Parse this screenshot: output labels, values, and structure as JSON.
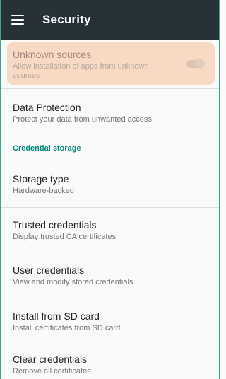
{
  "appbar": {
    "title": "Security",
    "menu_icon": "hamburger-menu-icon",
    "background": "#263238"
  },
  "colors": {
    "accent": "#00897b",
    "highlight": "#f8d9c3"
  },
  "items": {
    "unknown_sources": {
      "title": "Unknown sources",
      "subtitle": "Allow installation of apps from unknown sources",
      "toggle_on": false
    },
    "data_protection": {
      "title": "Data Protection",
      "subtitle": "Protect your data from unwanted access"
    },
    "section_credential_storage": "Credential storage",
    "storage_type": {
      "title": "Storage type",
      "subtitle": "Hardware-backed"
    },
    "trusted_credentials": {
      "title": "Trusted credentials",
      "subtitle": "Display trusted CA certificates"
    },
    "user_credentials": {
      "title": "User credentials",
      "subtitle": "View and modify stored credentials"
    },
    "install_sd": {
      "title": "Install from SD card",
      "subtitle": "Install certificates from SD card"
    },
    "clear_credentials": {
      "title": "Clear credentials",
      "subtitle": "Remove all certificates"
    }
  }
}
